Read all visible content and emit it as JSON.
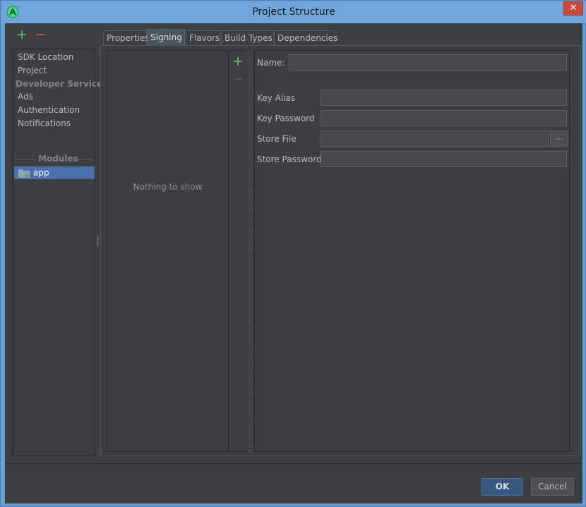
{
  "window": {
    "title": "Project Structure",
    "close_label": "✕"
  },
  "left_toolbar": {
    "add_icon": "plus-icon",
    "remove_icon": "minus-icon"
  },
  "sidebar": {
    "items": [
      {
        "label": "SDK Location"
      },
      {
        "label": "Project"
      }
    ],
    "section_developer": "Developer Services",
    "developer_items": [
      {
        "label": "Ads"
      },
      {
        "label": "Authentication"
      },
      {
        "label": "Notifications"
      }
    ],
    "section_modules": "Modules",
    "modules": [
      {
        "label": "app",
        "selected": true
      }
    ]
  },
  "tabs": [
    {
      "label": "Properties",
      "active": false
    },
    {
      "label": "Signing",
      "active": true
    },
    {
      "label": "Flavors",
      "active": false
    },
    {
      "label": "Build Types",
      "active": false
    },
    {
      "label": "Dependencies",
      "active": false
    }
  ],
  "signing": {
    "list_empty_text": "Nothing to show",
    "fields": {
      "name_label": "Name:",
      "name_value": "",
      "key_alias_label": "Key Alias",
      "key_alias_value": "",
      "key_password_label": "Key Password",
      "key_password_value": "",
      "store_file_label": "Store File",
      "store_file_value": "",
      "store_file_browse": "...",
      "store_password_label": "Store Password",
      "store_password_value": ""
    }
  },
  "footer": {
    "ok_label": "OK",
    "cancel_label": "Cancel"
  },
  "colors": {
    "accent": "#4b6eaf",
    "background": "#3c3f41",
    "add_green": "#59a869",
    "remove_red": "#c75450",
    "titlebar": "#6fa6dc",
    "close_red": "#c94a3f"
  }
}
